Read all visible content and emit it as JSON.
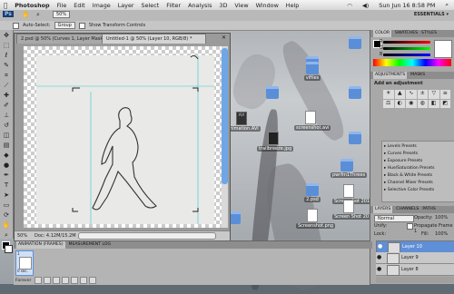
{
  "menubar": {
    "app": "Photoshop",
    "items": [
      "File",
      "Edit",
      "Image",
      "Layer",
      "Select",
      "Filter",
      "Analysis",
      "3D",
      "View",
      "Window",
      "Help"
    ],
    "ps_logo": "Ps",
    "zoom_select": "50%",
    "clock": "Sun Jun 16  8:58 PM",
    "workspace": "ESSENTIALS ▾"
  },
  "options": {
    "auto_select_label": "Auto-Select:",
    "auto_select_value": "Group",
    "transform_label": "Show Transform Controls"
  },
  "document": {
    "tabs": [
      "2.psd @ 50% (Curves 1, Layer Mask/8) *",
      "Untitled-1 @ 50% (Layer 10, RGB/8) *"
    ],
    "title": "Untitled-1 @ 50% (Layer 10, RGB/8) *",
    "zoom": "50%",
    "doc_size": "Doc: 4.12M/15.2M"
  },
  "desktop_icons": [
    {
      "label": "",
      "type": "folder"
    },
    {
      "label": "",
      "type": "folder"
    },
    {
      "label": "vifiles",
      "type": "folder"
    },
    {
      "label": "",
      "type": "folder"
    },
    {
      "label": "",
      "type": "folder"
    },
    {
      "label": "animation.AVI",
      "type": "film"
    },
    {
      "label": "screenshot.avi",
      "type": "file"
    },
    {
      "label": "trailbreeze.jpg",
      "type": "file"
    },
    {
      "label": "",
      "type": "folder"
    },
    {
      "label": "pwrfm1Threes",
      "type": "folder"
    },
    {
      "label": "2.psd",
      "type": "folder"
    },
    {
      "label": "Screenshot 2013-06-1...",
      "type": "file"
    },
    {
      "label": "Screen Shot 2013-06-1...",
      "type": "file"
    },
    {
      "label": "Screenshot.png",
      "type": "file"
    },
    {
      "label": "",
      "type": "folder"
    }
  ],
  "panels": {
    "color_tabs": [
      "COLOR",
      "SWATCHES",
      "STYLES"
    ],
    "rgb": [
      "R",
      "G",
      "B"
    ],
    "rgb_values": [
      "",
      "",
      ""
    ],
    "adjustments_tabs": [
      "ADJUSTMENTS",
      "MASKS"
    ],
    "add_adjustment": "Add an adjustment",
    "presets": [
      "Levels Presets",
      "Curves Presets",
      "Exposure Presets",
      "Hue/Saturation Presets",
      "Black & White Presets",
      "Channel Mixer Presets",
      "Selective Color Presets"
    ],
    "layers_tabs": [
      "LAYERS",
      "CHANNELS",
      "PATHS"
    ],
    "blend_mode": "Normal",
    "opacity_label": "Opacity:",
    "opacity": "100%",
    "unify_label": "Unify:",
    "propagate_label": "Propagate Frame 1",
    "lock_label": "Lock:",
    "fill_label": "Fill:",
    "fill": "100%",
    "layers": [
      "Layer 10",
      "Layer 9",
      "Layer 8"
    ]
  },
  "animation": {
    "tabs": [
      "ANIMATION (FRAMES)",
      "MEASUREMENT LOG"
    ],
    "frame_number": "1",
    "frame_delay": "0 sec.",
    "loop": "Forever"
  },
  "colors": {
    "accent": "#5f8fd6",
    "scroll_thumb": "#6ea6e6",
    "folder": "#5a8fd8"
  }
}
